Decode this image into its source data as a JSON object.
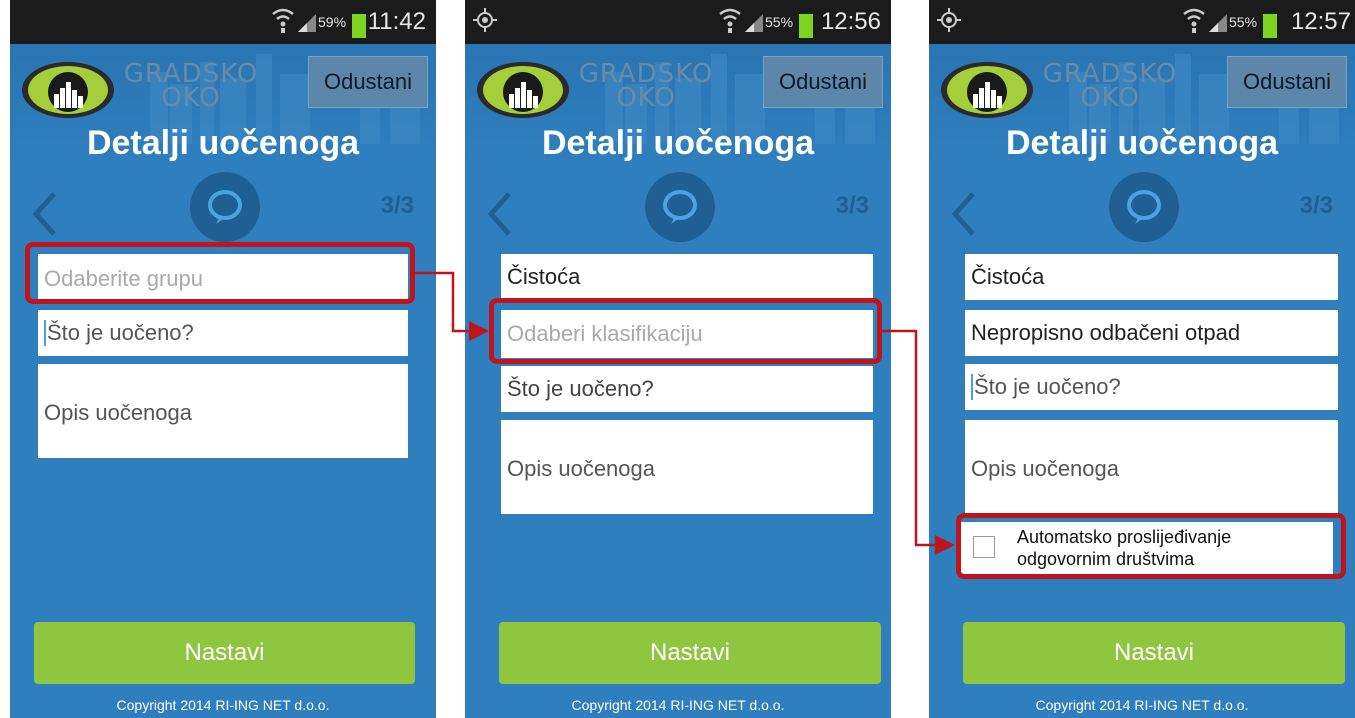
{
  "screens": [
    {
      "status": {
        "battery": "59%",
        "time": "11:42"
      },
      "logo_line1": "GRADSKO",
      "logo_line2": "OKO",
      "cancel": "Odustani",
      "title": "Detalji uočenoga",
      "step": "3/3",
      "fields": {
        "group_placeholder": "Odaberite grupu",
        "what_placeholder": "Što je uočeno?",
        "desc_placeholder": "Opis uočenoga"
      },
      "submit": "Nastavi",
      "copyright": "Copyright 2014 RI-ING NET d.o.o."
    },
    {
      "status": {
        "battery": "55%",
        "time": "12:56"
      },
      "logo_line1": "GRADSKO",
      "logo_line2": "OKO",
      "cancel": "Odustani",
      "title": "Detalji uočenoga",
      "step": "3/3",
      "fields": {
        "group_value": "Čistoća",
        "classification_placeholder": "Odaberi klasifikaciju",
        "what_placeholder": "Što je uočeno?",
        "desc_placeholder": "Opis uočenoga"
      },
      "submit": "Nastavi",
      "copyright": "Copyright 2014 RI-ING NET d.o.o."
    },
    {
      "status": {
        "battery": "55%",
        "time": "12:57"
      },
      "logo_line1": "GRADSKO",
      "logo_line2": "OKO",
      "cancel": "Odustani",
      "title": "Detalji uočenoga",
      "step": "3/3",
      "fields": {
        "group_value": "Čistoća",
        "classification_value": "Nepropisno odbačeni otpad",
        "what_placeholder": "Što je uočeno?",
        "desc_placeholder": "Opis uočenoga"
      },
      "checkbox_label": "Automatsko proslijeđivanje odgovornim društvima",
      "submit": "Nastavi",
      "copyright": "Copyright 2014 RI-ING NET d.o.o."
    }
  ],
  "colors": {
    "background": "#2f7fbe",
    "submit": "#8fc63f",
    "highlight": "#c0141c",
    "statusbar": "#1b1b1b"
  },
  "icons": {
    "status": [
      "wifi-icon",
      "signal-icon",
      "battery-icon",
      "gps-icon"
    ],
    "nav": [
      "back-arrow-icon",
      "speech-bubble-icon"
    ],
    "logo": "eye-city-logo"
  }
}
